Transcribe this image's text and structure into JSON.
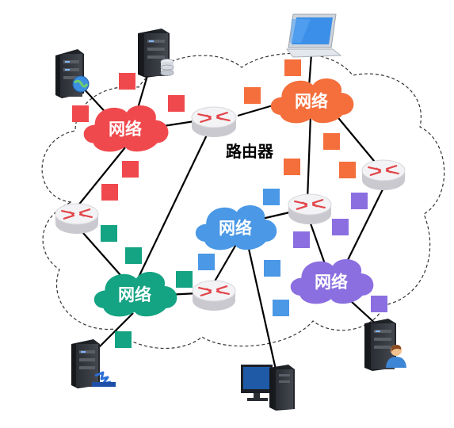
{
  "labels": {
    "network": "网络",
    "router": "路由器"
  },
  "colors": {
    "red": "#f0494d",
    "orange": "#f46f3c",
    "green": "#14a383",
    "blue": "#4a98e6",
    "purple": "#8b6fe0",
    "router_top": "#f3f3f5",
    "router_side": "#c9c9cf",
    "router_arrow": "#e2454a",
    "cloud_border": "#333333"
  },
  "icons": [
    "server-globe-icon",
    "server-database-icon",
    "laptop-icon",
    "server-network-icon",
    "desktop-computer-icon",
    "server-user-icon",
    "router-icon",
    "data-packet-icon"
  ]
}
